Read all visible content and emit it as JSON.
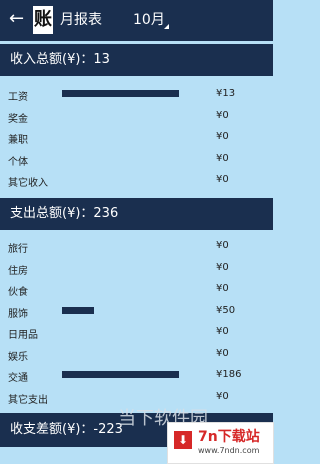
{
  "header": {
    "back_icon": "←",
    "logo_char": "账",
    "title": "月报表",
    "month": "10月"
  },
  "income": {
    "total_label": "收入总额(¥)：13",
    "rows": [
      {
        "label": "工资",
        "value": "¥13",
        "bar_fraction": 1.0
      },
      {
        "label": "奖金",
        "value": "¥0",
        "bar_fraction": 0
      },
      {
        "label": "兼职",
        "value": "¥0",
        "bar_fraction": 0
      },
      {
        "label": "个体",
        "value": "¥0",
        "bar_fraction": 0
      },
      {
        "label": "其它收入",
        "value": "¥0",
        "bar_fraction": 0
      }
    ]
  },
  "expense": {
    "total_label": "支出总额(¥)：236",
    "rows": [
      {
        "label": "旅行",
        "value": "¥0",
        "bar_fraction": 0
      },
      {
        "label": "住房",
        "value": "¥0",
        "bar_fraction": 0
      },
      {
        "label": "伙食",
        "value": "¥0",
        "bar_fraction": 0
      },
      {
        "label": "服饰",
        "value": "¥50",
        "bar_fraction": 0.27
      },
      {
        "label": "日用品",
        "value": "¥0",
        "bar_fraction": 0
      },
      {
        "label": "娱乐",
        "value": "¥0",
        "bar_fraction": 0
      },
      {
        "label": "交通",
        "value": "¥186",
        "bar_fraction": 1.0
      },
      {
        "label": "其它支出",
        "value": "¥0",
        "bar_fraction": 0
      }
    ]
  },
  "balance": {
    "label": "收支差额(¥)：-223"
  },
  "watermark": {
    "text": "当下软件园",
    "icon": "⬇",
    "name": "7n下载站",
    "url": "www.7ndn.com"
  },
  "colors": {
    "header_bg": "#1a2f4f",
    "page_bg": "#b7e0f6",
    "bar": "#1a2f4f"
  }
}
